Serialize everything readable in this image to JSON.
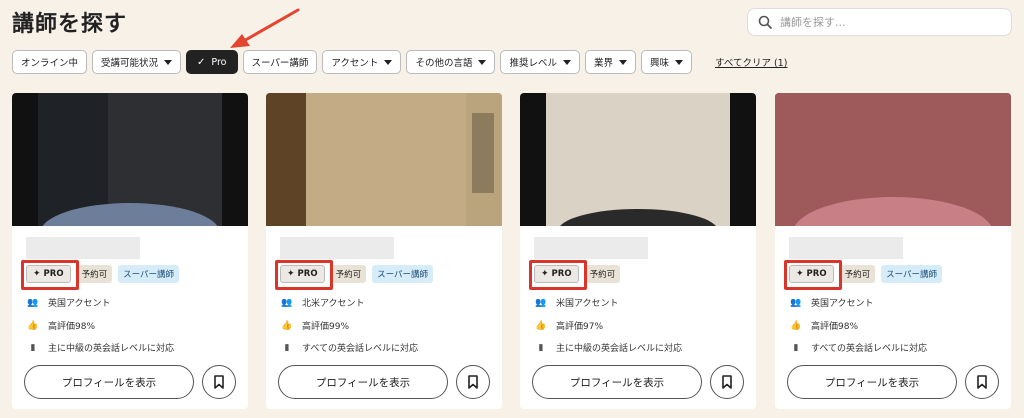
{
  "header": {
    "title": "講師を探す"
  },
  "search": {
    "placeholder": "講師を探す..."
  },
  "filters": [
    {
      "label": "オンライン中",
      "dropdown": false
    },
    {
      "label": "受講可能状況",
      "dropdown": true
    },
    {
      "label": "Pro",
      "active": true
    },
    {
      "label": "スーパー講師",
      "dropdown": false
    },
    {
      "label": "アクセント",
      "dropdown": true
    },
    {
      "label": "その他の言語",
      "dropdown": true
    },
    {
      "label": "推奨レベル",
      "dropdown": true
    },
    {
      "label": "業界",
      "dropdown": true
    },
    {
      "label": "興味",
      "dropdown": true
    }
  ],
  "clear_all": "すべてクリア (1)",
  "badge_labels": {
    "pro": "PRO",
    "bookable": "予約可",
    "super": "スーパー講師"
  },
  "profile_button_label": "プロフィールを表示",
  "tutors": [
    {
      "accent": "英国アクセント",
      "rating": "高評価98%",
      "level": "主に中級の英会話レベルに対応",
      "badges": [
        "pro",
        "bookable",
        "super"
      ]
    },
    {
      "accent": "北米アクセント",
      "rating": "高評価99%",
      "level": "すべての英会話レベルに対応",
      "badges": [
        "pro",
        "bookable",
        "super"
      ]
    },
    {
      "accent": "米国アクセント",
      "rating": "高評価97%",
      "level": "主に中級の英会話レベルに対応",
      "badges": [
        "pro",
        "bookable"
      ]
    },
    {
      "accent": "英国アクセント",
      "rating": "高評価98%",
      "level": "すべての英会話レベルに対応",
      "badges": [
        "pro",
        "bookable",
        "super"
      ]
    }
  ],
  "colors": {
    "background": "#f7f1e8",
    "highlight": "#d9352b",
    "active_chip": "#222222",
    "super_badge": "#d6ecf8"
  }
}
